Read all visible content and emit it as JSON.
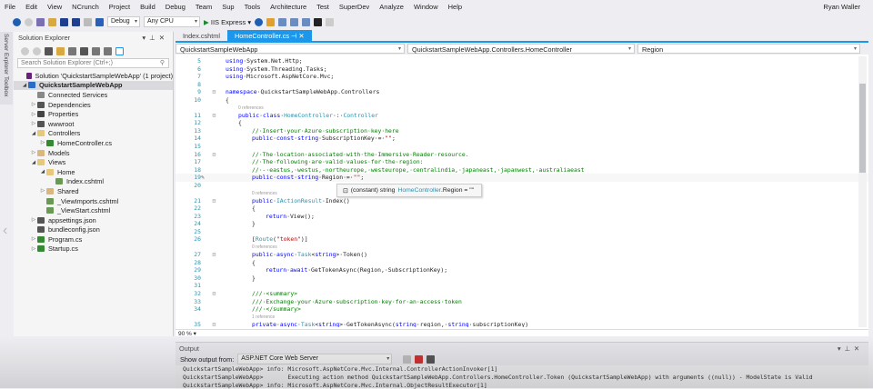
{
  "menu": [
    "File",
    "Edit",
    "View",
    "NCrunch",
    "Project",
    "Build",
    "Debug",
    "Team",
    "Sup",
    "Tools",
    "Architecture",
    "Test",
    "SuperDev",
    "Analyze",
    "Window",
    "Help"
  ],
  "user": "Ryan Waller",
  "toolbar": {
    "config": "Debug",
    "platform": "Any CPU",
    "run": "IIS Express"
  },
  "side_tabs": [
    "Server Explorer",
    "Toolbox"
  ],
  "solution_explorer": {
    "title": "Solution Explorer",
    "search_placeholder": "Search Solution Explorer (Ctrl+;)",
    "items": [
      {
        "label": "Solution 'QuickstartSampleWebApp' (1 project)",
        "level": 0,
        "toggle": "",
        "icon": "solution-icon"
      },
      {
        "label": "QuickstartSampleWebApp",
        "level": 0,
        "toggle": "◢",
        "icon": "project-icon",
        "bold": true,
        "selected": true
      },
      {
        "label": "Connected Services",
        "level": 1,
        "toggle": "",
        "icon": "cloud-icon"
      },
      {
        "label": "Dependencies",
        "level": 1,
        "toggle": "▷",
        "icon": "dependencies-icon"
      },
      {
        "label": "Properties",
        "level": 1,
        "toggle": "▷",
        "icon": "wrench-icon"
      },
      {
        "label": "wwwroot",
        "level": 1,
        "toggle": "▷",
        "icon": "globe-icon"
      },
      {
        "label": "Controllers",
        "level": 1,
        "toggle": "◢",
        "icon": "folder-open-icon"
      },
      {
        "label": "HomeController.cs",
        "level": 2,
        "toggle": "▷",
        "icon": "csharp-file-icon"
      },
      {
        "label": "Models",
        "level": 1,
        "toggle": "▷",
        "icon": "folder-icon"
      },
      {
        "label": "Views",
        "level": 1,
        "toggle": "◢",
        "icon": "folder-open-icon"
      },
      {
        "label": "Home",
        "level": 2,
        "toggle": "◢",
        "icon": "folder-open-icon"
      },
      {
        "label": "Index.cshtml",
        "level": 3,
        "toggle": "",
        "icon": "cshtml-file-icon"
      },
      {
        "label": "Shared",
        "level": 2,
        "toggle": "▷",
        "icon": "folder-icon"
      },
      {
        "label": "_ViewImports.cshtml",
        "level": 2,
        "toggle": "",
        "icon": "cshtml-file-icon"
      },
      {
        "label": "_ViewStart.cshtml",
        "level": 2,
        "toggle": "",
        "icon": "cshtml-file-icon"
      },
      {
        "label": "appsettings.json",
        "level": 1,
        "toggle": "▷",
        "icon": "json-file-icon"
      },
      {
        "label": "bundleconfig.json",
        "level": 1,
        "toggle": "",
        "icon": "json-file-icon"
      },
      {
        "label": "Program.cs",
        "level": 1,
        "toggle": "▷",
        "icon": "csharp-file-icon"
      },
      {
        "label": "Startup.cs",
        "level": 1,
        "toggle": "▷",
        "icon": "csharp-file-icon"
      }
    ]
  },
  "editor": {
    "tabs": [
      {
        "label": "Index.cshtml",
        "active": false
      },
      {
        "label": "HomeController.cs",
        "active": true
      }
    ],
    "nav": {
      "project": "QuickstartSampleWebApp",
      "class": "QuickstartSampleWebApp.Controllers.HomeController",
      "member": "Region"
    },
    "zoom": "90 %",
    "tooltip": {
      "prefix": "(constant) string",
      "type": "HomeController",
      "suffix": ".Region = \"\""
    },
    "lines": [
      {
        "n": "5",
        "i": 0,
        "seg": [
          [
            "kw",
            "using"
          ],
          [
            "tx",
            "·System.Net.Http;"
          ]
        ]
      },
      {
        "n": "6",
        "i": 0,
        "seg": [
          [
            "kw",
            "using"
          ],
          [
            "tx",
            "·System.Threading.Tasks;"
          ]
        ]
      },
      {
        "n": "7",
        "i": 0,
        "seg": [
          [
            "kw",
            "using"
          ],
          [
            "tx",
            "·Microsoft.AspNetCore.Mvc;"
          ]
        ]
      },
      {
        "n": "8",
        "i": 0,
        "seg": []
      },
      {
        "n": "9",
        "i": 0,
        "fold": true,
        "seg": [
          [
            "kw",
            "namespace"
          ],
          [
            "tx",
            "·QuickstartSampleWebApp.Controllers"
          ]
        ]
      },
      {
        "n": "10",
        "i": 0,
        "seg": [
          [
            "tx",
            "{"
          ]
        ]
      },
      {
        "lens": "0 references",
        "i": 1
      },
      {
        "n": "11",
        "i": 1,
        "fold": true,
        "seg": [
          [
            "kw",
            "public"
          ],
          [
            "tx",
            "·"
          ],
          [
            "kw",
            "class"
          ],
          [
            "tx",
            "·"
          ],
          [
            "ty",
            "HomeController"
          ],
          [
            "tx",
            "·:·"
          ],
          [
            "ty",
            "Controller"
          ]
        ]
      },
      {
        "n": "12",
        "i": 1,
        "seg": [
          [
            "tx",
            "{"
          ]
        ]
      },
      {
        "n": "13",
        "i": 2,
        "seg": [
          [
            "cm",
            "//·Insert·your·Azure·subscription·key·here"
          ]
        ]
      },
      {
        "n": "14",
        "i": 2,
        "seg": [
          [
            "kw",
            "public"
          ],
          [
            "tx",
            "·"
          ],
          [
            "kw",
            "const"
          ],
          [
            "tx",
            "·"
          ],
          [
            "kw",
            "string"
          ],
          [
            "tx",
            "·SubscriptionKey·=·"
          ],
          [
            "st",
            "\"\""
          ],
          [
            "tx",
            ";"
          ]
        ]
      },
      {
        "n": "15",
        "i": 2,
        "seg": []
      },
      {
        "n": "16",
        "i": 2,
        "fold": true,
        "seg": [
          [
            "cm",
            "//·The·location·associated·with·the·Immersive·Reader·resource."
          ]
        ]
      },
      {
        "n": "17",
        "i": 2,
        "seg": [
          [
            "cm",
            "//·The·following·are·valid·values·for·the·region:"
          ]
        ]
      },
      {
        "n": "18",
        "i": 2,
        "seg": [
          [
            "cm",
            "//·-·eastus,·westus,·northeurope,·westeurope,·centralindia,·japaneast,·japanwest,·australiaeast"
          ]
        ]
      },
      {
        "n": "19",
        "i": 2,
        "seg": [
          [
            "kw",
            "public"
          ],
          [
            "tx",
            "·"
          ],
          [
            "kw",
            "const"
          ],
          [
            "tx",
            "·"
          ],
          [
            "kw",
            "string"
          ],
          [
            "tx",
            "·Region·=·"
          ],
          [
            "st",
            "\"\""
          ],
          [
            "tx",
            ";"
          ]
        ]
      },
      {
        "n": "20",
        "i": 2,
        "seg": []
      },
      {
        "lens": "0 references",
        "i": 2
      },
      {
        "n": "21",
        "i": 2,
        "fold": true,
        "seg": [
          [
            "kw",
            "public"
          ],
          [
            "tx",
            "·"
          ],
          [
            "ty",
            "IActionResult"
          ],
          [
            "tx",
            "·Index()"
          ]
        ]
      },
      {
        "n": "22",
        "i": 2,
        "seg": [
          [
            "tx",
            "{"
          ]
        ]
      },
      {
        "n": "23",
        "i": 3,
        "seg": [
          [
            "kw",
            "return"
          ],
          [
            "tx",
            "·View();"
          ]
        ]
      },
      {
        "n": "24",
        "i": 2,
        "seg": [
          [
            "tx",
            "}"
          ]
        ]
      },
      {
        "n": "25",
        "i": 2,
        "seg": []
      },
      {
        "n": "26",
        "i": 2,
        "seg": [
          [
            "tx",
            "["
          ],
          [
            "ty",
            "Route"
          ],
          [
            "tx",
            "("
          ],
          [
            "st",
            "\"token\""
          ],
          [
            "tx",
            ")]"
          ]
        ]
      },
      {
        "lens": "0 references",
        "i": 2
      },
      {
        "n": "27",
        "i": 2,
        "fold": true,
        "seg": [
          [
            "kw",
            "public"
          ],
          [
            "tx",
            "·"
          ],
          [
            "kw",
            "async"
          ],
          [
            "tx",
            "·"
          ],
          [
            "ty",
            "Task"
          ],
          [
            "tx",
            "<"
          ],
          [
            "kw",
            "string"
          ],
          [
            "tx",
            ">·Token()"
          ]
        ]
      },
      {
        "n": "28",
        "i": 2,
        "seg": [
          [
            "tx",
            "{"
          ]
        ]
      },
      {
        "n": "29",
        "i": 3,
        "seg": [
          [
            "kw",
            "return"
          ],
          [
            "tx",
            "·"
          ],
          [
            "kw",
            "await"
          ],
          [
            "tx",
            "·GetTokenAsync(Region,·SubscriptionKey);"
          ]
        ]
      },
      {
        "n": "30",
        "i": 2,
        "seg": [
          [
            "tx",
            "}"
          ]
        ]
      },
      {
        "n": "31",
        "i": 2,
        "seg": []
      },
      {
        "n": "32",
        "i": 2,
        "fold": true,
        "seg": [
          [
            "cm",
            "///·<summary>"
          ]
        ]
      },
      {
        "n": "33",
        "i": 2,
        "seg": [
          [
            "cm",
            "///·Exchange·your·Azure·subscription·key·for·an·access·token"
          ]
        ]
      },
      {
        "n": "34",
        "i": 2,
        "seg": [
          [
            "cm",
            "///·</summary>"
          ]
        ]
      },
      {
        "lens": "1 reference",
        "i": 2
      },
      {
        "n": "35",
        "i": 2,
        "fold": true,
        "seg": [
          [
            "kw",
            "private"
          ],
          [
            "tx",
            "·"
          ],
          [
            "kw",
            "async"
          ],
          [
            "tx",
            "·"
          ],
          [
            "ty",
            "Task"
          ],
          [
            "tx",
            "<"
          ],
          [
            "kw",
            "string"
          ],
          [
            "tx",
            ">·GetTokenAsync("
          ],
          [
            "kw",
            "string"
          ],
          [
            "tx",
            "·region,·"
          ],
          [
            "kw",
            "string"
          ],
          [
            "tx",
            "·subscriptionKey)"
          ]
        ]
      }
    ]
  },
  "output": {
    "title": "Output",
    "show_from_label": "Show output from:",
    "source": "ASP.NET Core Web Server",
    "lines": [
      "QuickstartSampleWebApp> info: Microsoft.AspNetCore.Mvc.Internal.ControllerActionInvoker[1]",
      "QuickstartSampleWebApp>       Executing action method QuickstartSampleWebApp.Controllers.HomeController.Token (QuickstartSampleWebApp) with arguments ((null)) - ModelState is Valid",
      "QuickstartSampleWebApp> info: Microsoft.AspNetCore.Mvc.Internal.ObjectResultExecutor[1]"
    ]
  },
  "colors": {
    "accent": "#1c97ea",
    "keyword": "#0000ff",
    "type": "#2b91af",
    "comment": "#008000",
    "string": "#a31515"
  }
}
